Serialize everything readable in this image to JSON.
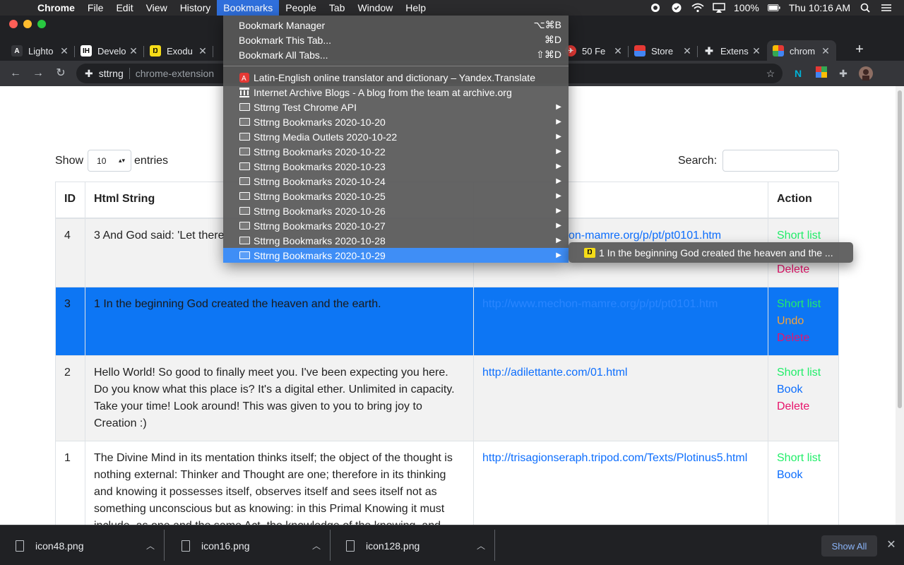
{
  "menubar": {
    "items": [
      "Chrome",
      "File",
      "Edit",
      "View",
      "History",
      "Bookmarks",
      "People",
      "Tab",
      "Window",
      "Help"
    ],
    "battery": "100%",
    "clock": "Thu 10:16 AM"
  },
  "tabs": [
    {
      "label": "Lighto",
      "icon": "lighthouse-icon"
    },
    {
      "label": "Develo",
      "icon": "ih-icon"
    },
    {
      "label": "Exodu",
      "icon": "exodus-icon"
    },
    {
      "label": "50 Fe",
      "icon": "plane-icon"
    },
    {
      "label": "Store",
      "icon": "store-icon"
    },
    {
      "label": "Extens",
      "icon": "puzzle-icon"
    },
    {
      "label": "chrom",
      "icon": "chrome-ext-icon"
    }
  ],
  "omnibox": {
    "chip": "sttrng",
    "url": "chrome-extension"
  },
  "bookmarks_menu": {
    "manager": {
      "label": "Bookmark Manager",
      "shortcut": "⌥⌘B"
    },
    "this_tab": {
      "label": "Bookmark This Tab...",
      "shortcut": "⌘D"
    },
    "all_tabs": {
      "label": "Bookmark All Tabs...",
      "shortcut": "⇧⌘D"
    },
    "links": [
      "Latin-English online translator and dictionary – Yandex.Translate",
      "Internet Archive Blogs - A blog from the team at archive.org"
    ],
    "folders": [
      "Sttrng Test Chrome API",
      "Sttrng Bookmarks 2020-10-20",
      "Sttrng Media Outlets 2020-10-22",
      "Sttrng Bookmarks 2020-10-22",
      "Sttrng Bookmarks 2020-10-23",
      "Sttrng Bookmarks 2020-10-24",
      "Sttrng Bookmarks 2020-10-25",
      "Sttrng Bookmarks 2020-10-26",
      "Sttrng Bookmarks 2020-10-27",
      "Sttrng Bookmarks 2020-10-28",
      "Sttrng Bookmarks 2020-10-29"
    ],
    "submenu_item": "1 In the beginning God created the heaven and the ..."
  },
  "page": {
    "show_label": "Show",
    "entries_label": "entries",
    "page_size": "10",
    "search_label": "Search:",
    "columns": [
      "ID",
      "Html String",
      "",
      "Action"
    ],
    "rows": [
      {
        "id": "4",
        "text": "3 And God said: 'Let there",
        "url": "on-mamre.org/p/pt/pt0101.htm",
        "actions": [
          "Short list",
          "",
          "Delete"
        ]
      },
      {
        "id": "3",
        "text": "1 In the beginning God created the heaven and the earth.",
        "url": "http://www.mechon-mamre.org/p/pt/pt0101.htm",
        "actions": [
          "Short list",
          "Undo",
          "Delete"
        ]
      },
      {
        "id": "2",
        "text": "Hello World! So good to finally meet you. I've been expecting you here. Do you know what this place is? It's a digital ether. Unlimited in capacity. Take your time! Look around! This was given to you to bring joy to Creation :)",
        "url": "http://adilettante.com/01.html",
        "actions": [
          "Short list",
          "Book",
          "Delete"
        ]
      },
      {
        "id": "1",
        "text": "The Divine Mind in its mentation thinks itself; the object of the thought is nothing external: Thinker and Thought are one; therefore in its thinking and knowing it possesses itself, observes itself and sees itself not as something unconscious but as knowing: in this Primal Knowing it must include, as one and the same Act, the knowledge of the knowing, and",
        "url": "http://trisagionseraph.tripod.com/Texts/Plotinus5.html",
        "actions": [
          "Short list",
          "Book"
        ]
      }
    ]
  },
  "downloads": {
    "files": [
      "icon48.png",
      "icon16.png",
      "icon128.png"
    ],
    "show_all": "Show All"
  }
}
